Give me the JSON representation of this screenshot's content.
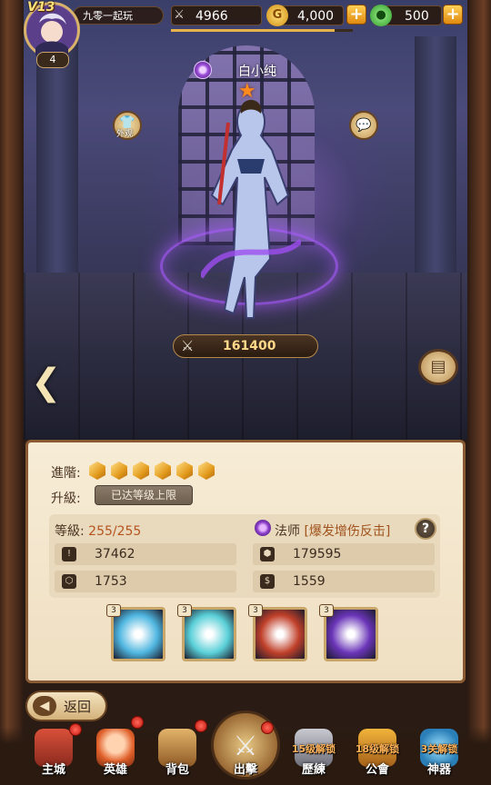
{
  "player": {
    "vip": "V13",
    "level": "4",
    "name": "九零一起玩"
  },
  "resources": {
    "power": "4966",
    "gold": "4,000",
    "potion": "500",
    "exp_progress": 0.9
  },
  "hero": {
    "name": "白小纯",
    "stars": 1,
    "combat_power": "161400",
    "skin_label": "外观"
  },
  "panel": {
    "advance_label": "進階:",
    "advance_gems": 6,
    "upgrade_label": "升級:",
    "max_level_button": "已达等级上限",
    "level_label": "等級:",
    "level_value": "255/255",
    "class_name": "法师",
    "class_desc": "[爆发增伤反击]",
    "help": "?",
    "stats": [
      "37462",
      "179595",
      "1753",
      "1559"
    ],
    "skills": [
      {
        "level": "3",
        "color": "#4fb6e0"
      },
      {
        "level": "3",
        "color": "#5ad0d8"
      },
      {
        "level": "3",
        "color": "#c0402a"
      },
      {
        "level": "3",
        "color": "#6a35b8"
      }
    ]
  },
  "back_button": "返回",
  "nav": [
    {
      "label": "主城",
      "lock": "",
      "dot": true
    },
    {
      "label": "英雄",
      "lock": "",
      "dot": true
    },
    {
      "label": "背包",
      "lock": "",
      "dot": true
    },
    {
      "label": "出擊",
      "lock": "",
      "dot": true
    },
    {
      "label": "歷練",
      "lock": "15级解锁",
      "dot": false
    },
    {
      "label": "公會",
      "lock": "18级解锁",
      "dot": false
    },
    {
      "label": "神器",
      "lock": "3关解锁",
      "dot": false
    }
  ]
}
